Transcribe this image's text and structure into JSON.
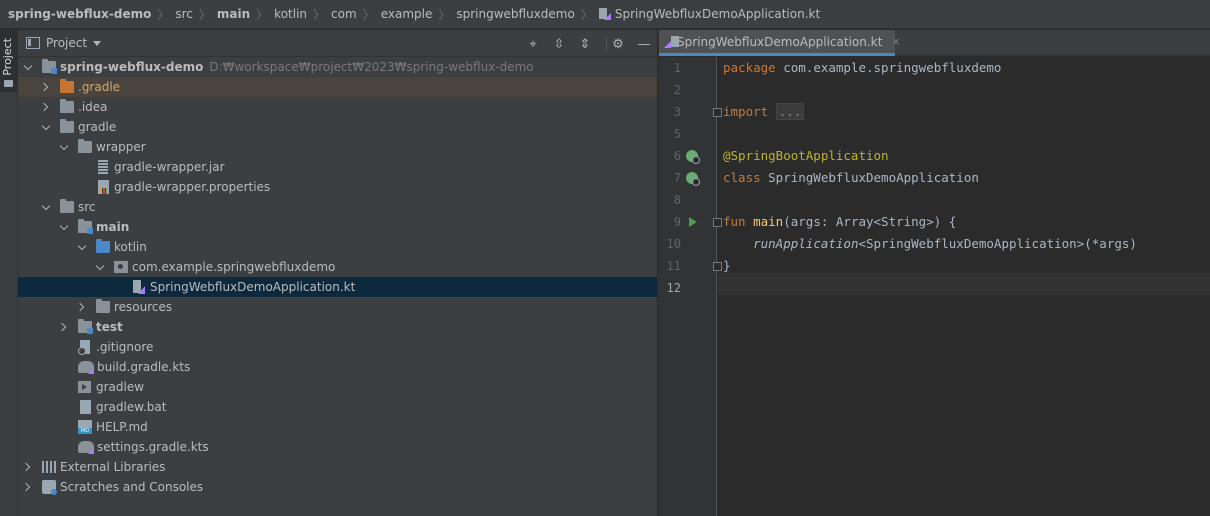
{
  "breadcrumbs": [
    {
      "label": "spring-webflux-demo",
      "bold": true
    },
    {
      "label": "src"
    },
    {
      "label": "main",
      "bold": true
    },
    {
      "label": "kotlin"
    },
    {
      "label": "com"
    },
    {
      "label": "example"
    },
    {
      "label": "springwebfluxdemo"
    },
    {
      "label": "SpringWebfluxDemoApplication.kt",
      "icon": "kotlin-file-icon"
    }
  ],
  "left_strip": {
    "project_label": "Project"
  },
  "project_panel": {
    "title": "Project",
    "actions": [
      {
        "name": "locate-icon",
        "glyph": "⌖"
      },
      {
        "name": "expand-all-icon",
        "glyph": "⇳"
      },
      {
        "name": "collapse-all-icon",
        "glyph": "⇕"
      },
      {
        "name": "gear-icon",
        "glyph": "⚙"
      },
      {
        "name": "hide-icon",
        "glyph": "—"
      }
    ]
  },
  "tree": [
    {
      "label": "spring-webflux-demo",
      "path": "D:₩workspace₩project₩2023₩spring-webflux-demo",
      "indent": 0,
      "arrow": "exp",
      "icon": "folder-mod",
      "bold": true
    },
    {
      "label": ".gradle",
      "indent": 1,
      "arrow": "col",
      "icon": "folder-orange",
      "highlight": true
    },
    {
      "label": ".idea",
      "indent": 1,
      "arrow": "col",
      "icon": "folder"
    },
    {
      "label": "gradle",
      "indent": 1,
      "arrow": "exp",
      "icon": "folder"
    },
    {
      "label": "wrapper",
      "indent": 2,
      "arrow": "exp",
      "icon": "folder"
    },
    {
      "label": "gradle-wrapper.jar",
      "indent": 3,
      "arrow": "none",
      "icon": "jar"
    },
    {
      "label": "gradle-wrapper.properties",
      "indent": 3,
      "arrow": "none",
      "icon": "props"
    },
    {
      "label": "src",
      "indent": 1,
      "arrow": "exp",
      "icon": "folder"
    },
    {
      "label": "main",
      "indent": 2,
      "arrow": "exp",
      "icon": "folder-mod",
      "bold": true
    },
    {
      "label": "kotlin",
      "indent": 3,
      "arrow": "exp",
      "icon": "folder-blue"
    },
    {
      "label": "com.example.springwebfluxdemo",
      "indent": 4,
      "arrow": "exp",
      "icon": "pkg"
    },
    {
      "label": "SpringWebfluxDemoApplication.kt",
      "indent": 5,
      "arrow": "none",
      "icon": "kt",
      "selected": true
    },
    {
      "label": "resources",
      "indent": 3,
      "arrow": "col",
      "icon": "folder-res"
    },
    {
      "label": "test",
      "indent": 2,
      "arrow": "col",
      "icon": "folder-mod",
      "bold": true
    },
    {
      "label": ".gitignore",
      "indent": 2,
      "arrow": "none",
      "icon": "git"
    },
    {
      "label": "build.gradle.kts",
      "indent": 2,
      "arrow": "none",
      "icon": "gradle"
    },
    {
      "label": "gradlew",
      "indent": 2,
      "arrow": "none",
      "icon": "shell"
    },
    {
      "label": "gradlew.bat",
      "indent": 2,
      "arrow": "none",
      "icon": "bat"
    },
    {
      "label": "HELP.md",
      "indent": 2,
      "arrow": "none",
      "icon": "md"
    },
    {
      "label": "settings.gradle.kts",
      "indent": 2,
      "arrow": "none",
      "icon": "gradle"
    },
    {
      "label": "External Libraries",
      "indent": 0,
      "arrow": "col",
      "icon": "libs"
    },
    {
      "label": "Scratches and Consoles",
      "indent": 0,
      "arrow": "col",
      "icon": "scratch"
    }
  ],
  "editor": {
    "tab_label": "SpringWebfluxDemoApplication.kt",
    "tab_close": "×",
    "current_line": 12,
    "lines": [
      {
        "n": "1",
        "tokens": [
          {
            "t": "package ",
            "c": "kw"
          },
          {
            "t": "com.example.springwebfluxdemo",
            "c": "pl"
          }
        ]
      },
      {
        "n": "2",
        "tokens": []
      },
      {
        "n": "3",
        "tokens": [
          {
            "t": "import ",
            "c": "kw"
          },
          {
            "t": "...",
            "c": "fold-dots"
          }
        ],
        "fold": true
      },
      {
        "n": "5",
        "tokens": []
      },
      {
        "n": "6",
        "tokens": [
          {
            "t": "@SpringBootApplication",
            "c": "ann"
          }
        ],
        "gutter": "spring-bean-icon"
      },
      {
        "n": "7",
        "tokens": [
          {
            "t": "class ",
            "c": "kw"
          },
          {
            "t": "SpringWebfluxDemoApplication",
            "c": "pl"
          }
        ],
        "gutter": "spring-bean-icon"
      },
      {
        "n": "8",
        "tokens": []
      },
      {
        "n": "9",
        "tokens": [
          {
            "t": "fun ",
            "c": "kw"
          },
          {
            "t": "main",
            "c": "fn"
          },
          {
            "t": "(args: Array<String>) {",
            "c": "pl"
          }
        ],
        "gutter": "run-icon",
        "fold": true
      },
      {
        "n": "10",
        "tokens": [
          {
            "t": "    ",
            "c": "pl"
          },
          {
            "t": "runApplication",
            "c": "ital"
          },
          {
            "t": "<SpringWebfluxDemoApplication>(*args)",
            "c": "pl"
          }
        ]
      },
      {
        "n": "11",
        "tokens": [
          {
            "t": "}",
            "c": "pl"
          }
        ],
        "fold": true
      },
      {
        "n": "12",
        "tokens": []
      }
    ]
  },
  "colors": {
    "keyword": "#cc7832",
    "annotation": "#bbb529",
    "function": "#ffc66d",
    "plain": "#a9b7c6",
    "selection": "#0d293e",
    "kotlin_accent": "#a97bff"
  }
}
